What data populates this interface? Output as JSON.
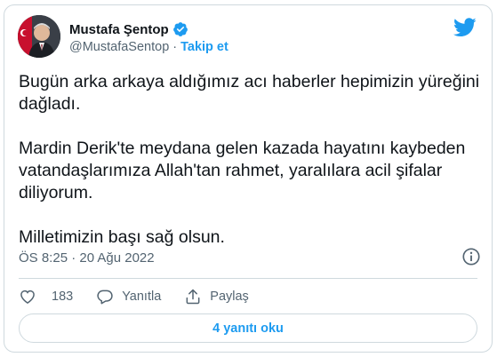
{
  "author": {
    "name": "Mustafa Şentop",
    "handle": "@MustafaSentop",
    "separator": "·",
    "follow_label": "Takip et"
  },
  "tweet": {
    "paragraphs": [
      "Bugün arka arkaya aldığımız acı haberler hepimizin yüreğini dağladı.",
      "Mardin Derik'te meydana gelen kazada hayatını kaybeden vatandaşlarımıza Allah'tan rahmet, yaralılara acil şifalar diliyorum.",
      "Milletimizin başı sağ olsun."
    ],
    "timestamp": "ÖS 8:25 · 20 Ağu 2022"
  },
  "actions": {
    "like_count": "183",
    "reply_label": "Yanıtla",
    "share_label": "Paylaş"
  },
  "replies_button": "4 yanıtı oku",
  "colors": {
    "accent": "#1d9bf0",
    "text": "#0f1419",
    "secondary": "#536471",
    "border": "#cfd9de"
  },
  "icons": [
    "verified-badge-icon",
    "twitter-bird-icon",
    "info-icon",
    "heart-icon",
    "reply-bubble-icon",
    "share-icon"
  ]
}
